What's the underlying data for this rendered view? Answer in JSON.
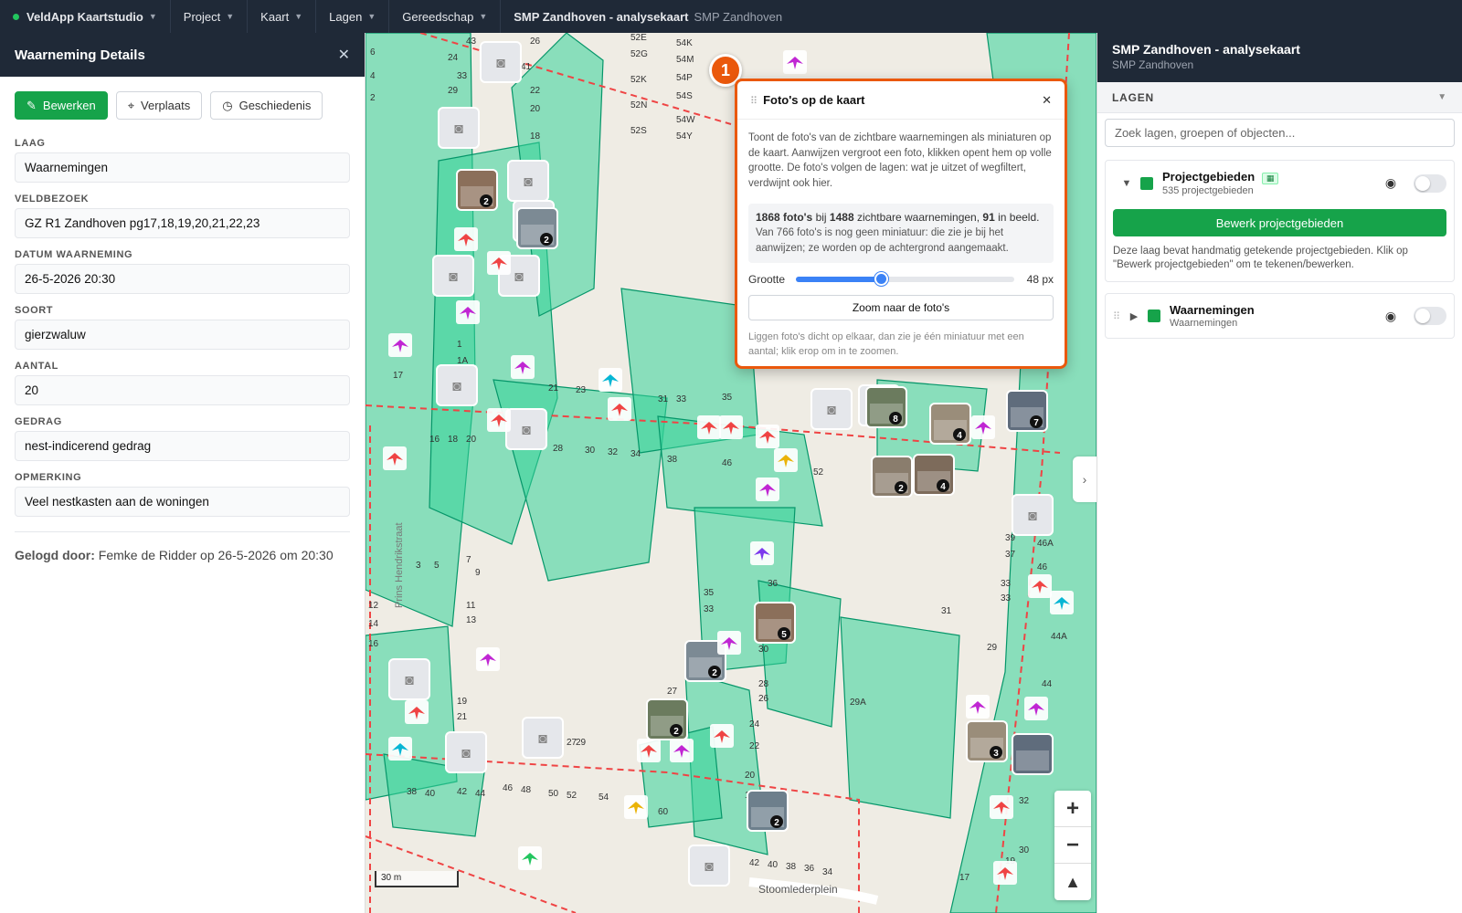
{
  "topbar": {
    "brand": "VeldApp Kaartstudio",
    "menus": [
      "Project",
      "Kaart",
      "Lagen",
      "Gereedschap"
    ],
    "title": "SMP Zandhoven - analysekaart",
    "subtitle": "SMP Zandhoven"
  },
  "details": {
    "title": "Waarneming Details",
    "buttons": {
      "edit": "Bewerken",
      "move": "Verplaats",
      "history": "Geschiedenis"
    },
    "fields": [
      {
        "label": "LAAG",
        "value": "Waarnemingen"
      },
      {
        "label": "VELDBEZOEK",
        "value": "GZ R1 Zandhoven pg17,18,19,20,21,22,23"
      },
      {
        "label": "DATUM WAARNEMING",
        "value": "26-5-2026 20:30"
      },
      {
        "label": "SOORT",
        "value": "gierzwaluw"
      },
      {
        "label": "AANTAL",
        "value": "20"
      },
      {
        "label": "GEDRAG",
        "value": "nest-indicerend gedrag"
      },
      {
        "label": "OPMERKING",
        "value": "Veel nestkasten aan de woningen"
      }
    ],
    "logged_label": "Gelogd door:",
    "logged_value": "Femke de Ridder op 26-5-2026 om 20:30"
  },
  "popup": {
    "step": "1",
    "title": "Foto's op de kaart",
    "description": "Toont de foto's van de zichtbare waarnemingen als miniaturen op de kaart. Aanwijzen vergroot een foto, klikken opent hem op volle grootte. De foto's volgen de lagen: wat je uitzet of wegfiltert, verdwijnt ook hier.",
    "stat_photos": "1868 foto's",
    "stat_mid": "bij",
    "stat_obs": "1488",
    "stat_mid2": "zichtbare waarnemingen,",
    "stat_view": "91",
    "stat_end": "in beeld.",
    "stat_note": "Van 766 foto's is nog geen miniatuur: die zie je bij het aanwijzen; ze worden op de achtergrond aangemaakt.",
    "size_label": "Grootte",
    "size_value": "48 px",
    "size_fraction": 0.39,
    "zoom_button": "Zoom naar de foto's",
    "hint": "Liggen foto's dicht op elkaar, dan zie je één miniatuur met een aantal; klik erop om in te zoomen."
  },
  "map": {
    "scale_label": "30 m",
    "street_1": "Prins Hendrikstraat",
    "street_2": "Stoomlederplein",
    "house_numbers": [
      "43",
      "26",
      "24",
      "41",
      "33",
      "29",
      "22",
      "20",
      "18",
      "52E",
      "52G",
      "52K",
      "52N",
      "52S",
      "54K",
      "54M",
      "54P",
      "54S",
      "54W",
      "54Y",
      "6",
      "4",
      "2",
      "1",
      "1A",
      "17",
      "21",
      "23",
      "31",
      "33",
      "35",
      "16",
      "18",
      "20",
      "28",
      "30",
      "32",
      "34",
      "38",
      "46",
      "52",
      "3",
      "5",
      "7",
      "9",
      "11",
      "13",
      "12",
      "14",
      "16",
      "35",
      "33",
      "36",
      "30",
      "28",
      "26",
      "27",
      "24",
      "22",
      "20",
      "18",
      "19",
      "21",
      "29",
      "27",
      "38",
      "40",
      "42",
      "44",
      "46",
      "48",
      "50",
      "52",
      "54",
      "60",
      "42",
      "40",
      "38",
      "36",
      "34",
      "39",
      "37",
      "46A",
      "46",
      "33",
      "33",
      "31",
      "29",
      "44A",
      "44",
      "29A",
      "32",
      "30",
      "19",
      "17"
    ],
    "cluster_counts": [
      "2",
      "2",
      "8",
      "4",
      "7",
      "2",
      "4",
      "2",
      "5",
      "2",
      "2",
      "3"
    ],
    "colors": {
      "polygon": "#34d399",
      "polygon_stroke": "#059669",
      "boundary": "#ef4444",
      "accent": "#ea580c"
    }
  },
  "layers": {
    "title": "SMP Zandhoven - analysekaart",
    "subtitle": "SMP Zandhoven",
    "section": "LAGEN",
    "search_placeholder": "Zoek lagen, groepen of objecten...",
    "items": [
      {
        "name": "Projectgebieden",
        "sub": "535 projectgebieden",
        "edit_button": "Bewerk projectgebieden",
        "info": "Deze laag bevat handmatig getekende projectgebieden. Klik op \"Bewerk projectgebieden\" om te tekenen/bewerken."
      },
      {
        "name": "Waarnemingen",
        "sub": "Waarnemingen"
      }
    ]
  }
}
